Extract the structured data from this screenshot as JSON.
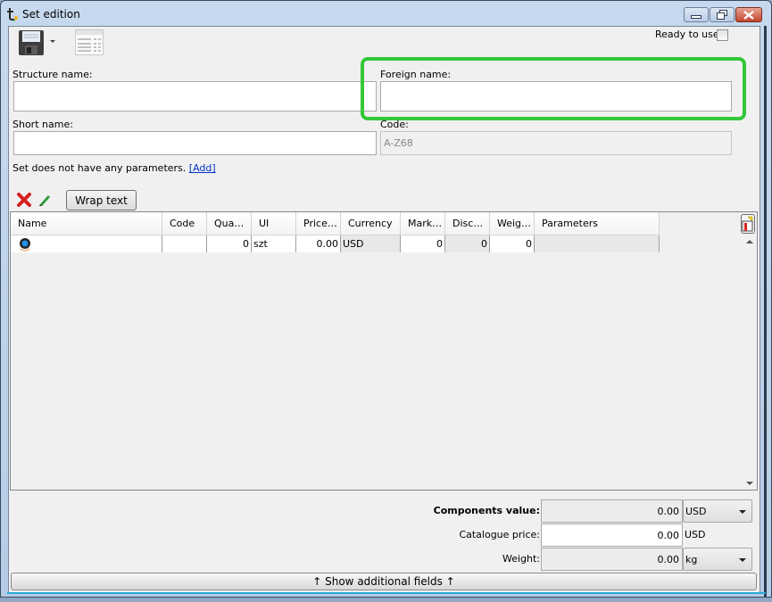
{
  "window": {
    "title": "Set edition",
    "controls": {
      "minimize": "minimize",
      "restore": "restore",
      "close": "close"
    }
  },
  "toolbar": {
    "save_icon": "floppy-disk-icon",
    "save_dropdown_icon": "dropdown-arrow-icon",
    "table_icon": "table-list-icon",
    "ready_to_use_label": "Ready to use",
    "ready_to_use_checked": false
  },
  "form": {
    "structure_name": {
      "label": "Structure name:",
      "value": ""
    },
    "foreign_name": {
      "label": "Foreign name:",
      "value": ""
    },
    "short_name": {
      "label": "Short name:",
      "value": ""
    },
    "code": {
      "label": "Code:",
      "value": "A-Z68"
    },
    "parameters_text": "Set does not have any parameters.",
    "parameters_add_link": "[Add]",
    "highlight_color": "#34c738"
  },
  "grid_toolbar": {
    "delete_icon": "red-x-delete-icon",
    "edit_icon": "green-pencil-icon",
    "wrap_text_label": "Wrap text"
  },
  "grid": {
    "columns": [
      "Name",
      "Code",
      "Qua…",
      "UI",
      "Price…",
      "Currency",
      "Mark…",
      "Disc…",
      "Weig…",
      "Parameters"
    ],
    "rows": [
      {
        "name_icon": "component-gear-icon",
        "name": "",
        "code": "",
        "quantity": "0",
        "ui": "szt",
        "price": "0.00",
        "currency": "USD",
        "markup": "0",
        "discount": "0",
        "weight": "0",
        "parameters": ""
      }
    ],
    "column_chooser_icon": "column-chooser-icon",
    "scroll_up_icon": "scroll-up-arrow-icon",
    "scroll_down_icon": "scroll-down-arrow-icon"
  },
  "summary": {
    "components_value": {
      "label": "Components value:",
      "value": "0.00",
      "currency": "USD"
    },
    "catalogue_price": {
      "label": "Catalogue price:",
      "value": "0.00",
      "currency": "USD"
    },
    "weight": {
      "label": "Weight:",
      "value": "0.00",
      "unit": "kg"
    }
  },
  "footer": {
    "show_additional_fields": "↑ Show additional fields ↑"
  }
}
